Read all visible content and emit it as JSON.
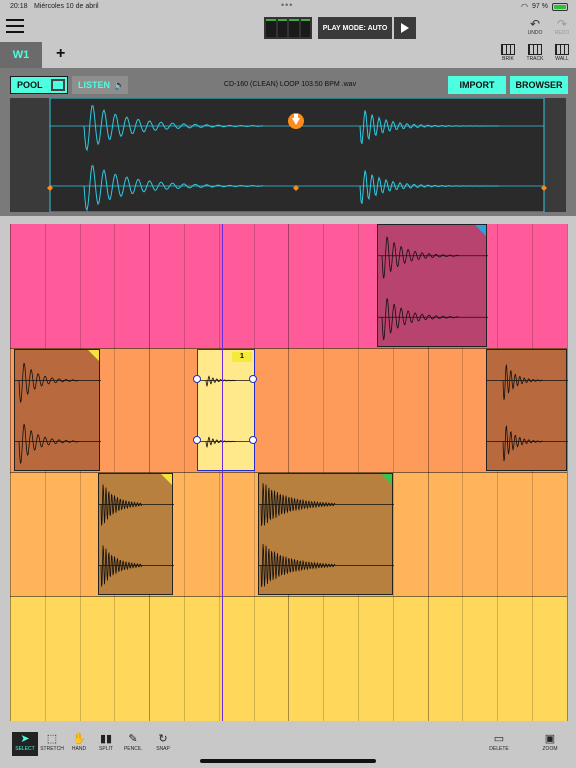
{
  "status": {
    "time": "20:18",
    "date": "Miércoles 10 de abril",
    "battery": "97 %"
  },
  "topbar": {
    "play_mode": "PLAY MODE: AUTO",
    "undo_label": "UNDO",
    "redo_label": "REDO"
  },
  "tabs": {
    "active": "W1",
    "add": "+"
  },
  "view_buttons": [
    {
      "label": "BRIK"
    },
    {
      "label": "TRACK"
    },
    {
      "label": "WALL"
    }
  ],
  "sample": {
    "pool_label": "POOL",
    "listen_label": "LISTEN",
    "filename": "CD-160 (CLEAN) LOOP 103.50 BPM .wav",
    "import_label": "IMPORT",
    "browser_label": "BROWSER"
  },
  "grid": {
    "lane_colors": [
      "#ff5b9a",
      "#ff9b5a",
      "#ffb35a",
      "#ffd75a"
    ],
    "selected_clip_number": "1"
  },
  "tools": [
    {
      "label": "SELECT",
      "icon": "cursor-icon",
      "active": true
    },
    {
      "label": "STRETCH",
      "icon": "stretch-icon",
      "active": false
    },
    {
      "label": "HAND",
      "icon": "hand-icon",
      "active": false
    },
    {
      "label": "SPLIT",
      "icon": "split-icon",
      "active": false
    },
    {
      "label": "PENCIL",
      "icon": "pencil-icon",
      "active": false
    },
    {
      "label": "SNAP",
      "icon": "snap-icon",
      "active": false
    }
  ],
  "right_tools": [
    {
      "label": "DELETE",
      "icon": "delete-icon"
    },
    {
      "label": "ZOOM",
      "icon": "zoom-icon"
    }
  ]
}
